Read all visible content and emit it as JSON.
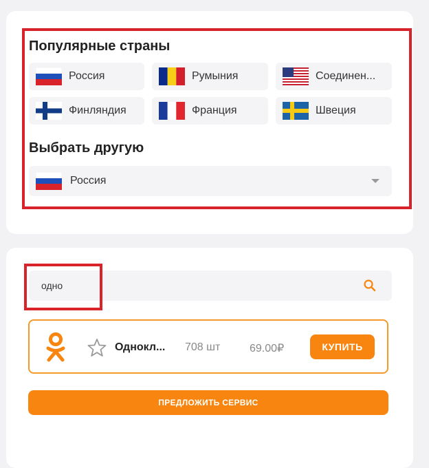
{
  "countries": {
    "popular_title": "Популярные страны",
    "popular": [
      {
        "name": "Россия",
        "flag": "russia-flag"
      },
      {
        "name": "Румыния",
        "flag": "romania-flag"
      },
      {
        "name": "Соединен...",
        "flag": "usa-flag"
      },
      {
        "name": "Финляндия",
        "flag": "finland-flag"
      },
      {
        "name": "Франция",
        "flag": "france-flag"
      },
      {
        "name": "Швеция",
        "flag": "sweden-flag"
      }
    ],
    "other_title": "Выбрать другую",
    "selected": {
      "name": "Россия",
      "flag": "russia-flag"
    }
  },
  "search": {
    "value": "одно",
    "icon": "search-icon"
  },
  "service": {
    "name": "Однокл...",
    "count": "708 шт",
    "price": "69.00₽",
    "buy_label": "КУПИТЬ",
    "icon": "odnoklassniki-icon"
  },
  "suggest_label": "ПРЕДЛОЖИТЬ СЕРВИС",
  "colors": {
    "accent": "#f7850f",
    "highlight": "#d8232a"
  }
}
